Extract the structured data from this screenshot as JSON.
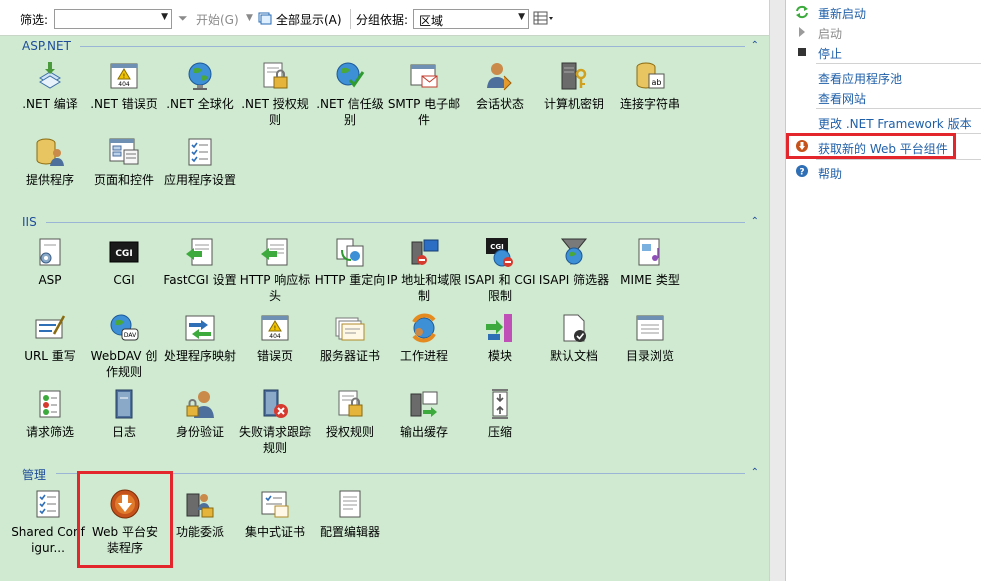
{
  "toolbar": {
    "filter_label": "筛选:",
    "filter_value": "",
    "start_label": "开始(G)",
    "show_all_label": "全部显示(A)",
    "group_by_label": "分组依据:",
    "group_by_value": "区域"
  },
  "sections": {
    "aspnet": {
      "title": "ASP.NET",
      "items": [
        {
          "label": ".NET 编译"
        },
        {
          "label": ".NET 错误页"
        },
        {
          "label": ".NET 全球化"
        },
        {
          "label": ".NET 授权规则"
        },
        {
          "label": ".NET 信任级别"
        },
        {
          "label": "SMTP 电子邮件"
        },
        {
          "label": "会话状态"
        },
        {
          "label": "计算机密钥"
        },
        {
          "label": "连接字符串"
        },
        {
          "label": "提供程序"
        },
        {
          "label": "页面和控件"
        },
        {
          "label": "应用程序设置"
        }
      ]
    },
    "iis": {
      "title": "IIS",
      "items": [
        {
          "label": "ASP"
        },
        {
          "label": "CGI"
        },
        {
          "label": "FastCGI 设置"
        },
        {
          "label": "HTTP 响应标头"
        },
        {
          "label": "HTTP 重定向"
        },
        {
          "label": "IP 地址和域限制"
        },
        {
          "label": "ISAPI 和 CGI 限制"
        },
        {
          "label": "ISAPI 筛选器"
        },
        {
          "label": "MIME 类型"
        },
        {
          "label": "URL 重写"
        },
        {
          "label": "WebDAV 创作规则"
        },
        {
          "label": "处理程序映射"
        },
        {
          "label": "错误页"
        },
        {
          "label": "服务器证书"
        },
        {
          "label": "工作进程"
        },
        {
          "label": "模块"
        },
        {
          "label": "默认文档"
        },
        {
          "label": "目录浏览"
        },
        {
          "label": "请求筛选"
        },
        {
          "label": "日志"
        },
        {
          "label": "身份验证"
        },
        {
          "label": "失败请求跟踪规则"
        },
        {
          "label": "授权规则"
        },
        {
          "label": "输出缓存"
        },
        {
          "label": "压缩"
        }
      ]
    },
    "manage": {
      "title": "管理",
      "items": [
        {
          "label": "Shared Configur..."
        },
        {
          "label": "Web 平台安装程序"
        },
        {
          "label": "功能委派"
        },
        {
          "label": "集中式证书"
        },
        {
          "label": "配置编辑器"
        }
      ]
    }
  },
  "actions": {
    "restart": "重新启动",
    "start": "启动",
    "stop": "停止",
    "view_app_pools": "查看应用程序池",
    "view_sites": "查看网站",
    "change_net_version": "更改 .NET Framework 版本",
    "get_web_platform": "获取新的 Web 平台组件",
    "help": "帮助"
  },
  "colors": {
    "main_bg": "#cfead0",
    "link": "#1f5fa8",
    "highlight": "#e3262c"
  }
}
